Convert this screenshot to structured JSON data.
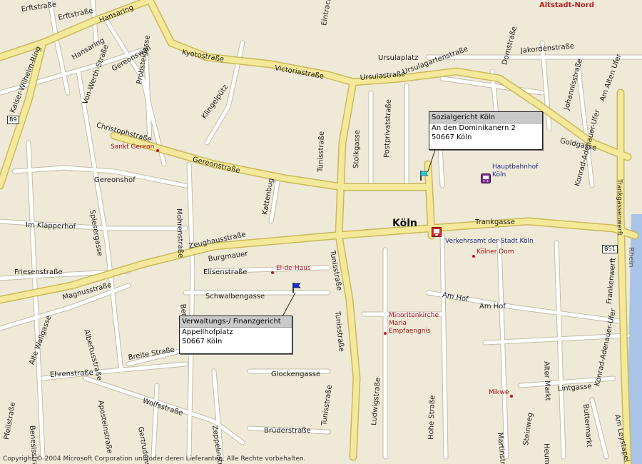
{
  "map": {
    "city_label": "Köln",
    "district_label": "Altstadt-Nord",
    "river_label": "Rhein",
    "copyright": "Copyright © 2004 Microsoft Corporation und/oder deren Lieferanten. Alle Rechte vorbehalten.",
    "shields": {
      "b9": "B9",
      "b51": "B51"
    },
    "colors": {
      "background": "#efe9d7",
      "major_road": "#f4e99a",
      "major_road_edge": "#c9b95a",
      "minor_road": "#ffffff",
      "minor_road_edge": "#c4bca8",
      "water": "#a9c4e6",
      "poi_red": "#a8101a",
      "poi_blue": "#1e2a8c"
    }
  },
  "streets": {
    "erftstrasse_1": "Erftstraße",
    "erftstrasse_2": "Erftstraße",
    "hansaring_1": "Hansaring",
    "hansaring_2": "Hansaring",
    "kyotostrasse": "Kyotostraße",
    "victoriastrasse": "Victoriastraße",
    "eintrachtstrasse": "Eintrachtstraße",
    "ursulaplatz": "Ursulaplatz",
    "ursulastrasse": "Ursulastraße",
    "ursulagartenstrasse": "Ursulagartenstraße",
    "domstrasse": "Domstraße",
    "jakordenstrasse": "Jakordenstraße",
    "johannisstrasse": "Johannisstraße",
    "goldgasse": "Goldgasse",
    "am_alten_ufer": "Am Alten Ufer",
    "kaiser_wilhelm_ring": "Kaiser-Wilhelm-Ring",
    "von_werth_strasse": "Von-Werth-Straße",
    "gereonswall": "Gereonswall",
    "probsteigasse": "Probsteigasse",
    "kluengelpuetz": "Klingelpütz",
    "christophstrasse": "Christophstraße",
    "gereonstrasse": "Gereonstraße",
    "gereonshof": "Gereonshof",
    "spiesergasse": "Spiesergasse",
    "mohrenstrasse": "Mohrenstraße",
    "katharinenstrasse": "Kattenbug",
    "tunisstrasse_1": "Tunisstraße",
    "tunisstrasse_2": "Tunisstraße",
    "tunisstrasse_3": "Tunisstraße",
    "tunisstrasse_4": "Tunisstraße",
    "stolkgasse": "Stolkgasse",
    "postprivatstrasse": "Postprivatstraße",
    "trankgasse": "Trankgasse",
    "konrad_adenauer_ufer_1": "Konrad-Adenauer-Ufer",
    "konrad_adenauer_ufer_2": "Konrad-Adenauer-Ufer",
    "trankgassenwerft": "Trankgassenwerft",
    "im_klapperhof": "Im Klapperhof",
    "zeughausstrasse": "Zeughausstraße",
    "burgmauer": "Burgmauer",
    "friesenstrasse": "Friesenstraße",
    "elisenstrasse": "Elisenstraße",
    "schwalbengasse": "Schwalbengasse",
    "magnusstrasse": "Magnusstraße",
    "albertusstrasse": "Albertusstraße",
    "berlich": "Berlich",
    "am_hof_1": "Am Hof",
    "am_hof_2": "Am Hof",
    "frankenwerft": "Frankenwerft",
    "alte_wallgasse": "Alte Wallgasse",
    "ehrenstrasse": "Ehrenstraße",
    "apostelnstrasse": "Apostelnstraße",
    "breite_strasse": "Breite Straße",
    "glockengasse": "Glockengasse",
    "wolfsstrasse": "Wolfsstraße",
    "gertrudenstrasse": "Gertrudenstraße",
    "zeppelinstrasse": "Zeppelinstraße",
    "bruederstrasse": "Brüderstraße",
    "ludwigstrasse": "Ludwigstraße",
    "hohe_strasse": "Hohe Straße",
    "martinstrasse": "Martinstraße",
    "steinweg": "Steinweg",
    "alter_markt": "Alter Markt",
    "lintgasse": "Lintgasse",
    "buttermarkt": "Buttermarkt",
    "heumarkt": "Heumarkt",
    "am_leystapel": "Am Leystapel",
    "pfeilstrasse": "Pfeilstraße",
    "benesisstrasse": "Benesisstraße"
  },
  "pois": {
    "sankt_gereon": "Sankt Gereon",
    "hauptbahnhof": "Hauptbahnhof\nKöln",
    "el_de_haus": "El-de-Haus",
    "verkehrsamt": "Verkehrsamt der Stadt Köln",
    "koelner_dom": "Kölner Dom",
    "minoritenkirche": "Minoritenkirche\nMaria\nEmpfaengnis",
    "mikwe": "Mikwe"
  },
  "callouts": {
    "sozialgericht": {
      "title": "Sozialgericht Köln",
      "line1": "An den Dominikanern 2",
      "line2": "50667 Köln"
    },
    "finanzgericht": {
      "title": "Verwaltungs-/ Finanzgericht",
      "line1": "Appellhofplatz",
      "line2": "50667 Köln"
    }
  }
}
